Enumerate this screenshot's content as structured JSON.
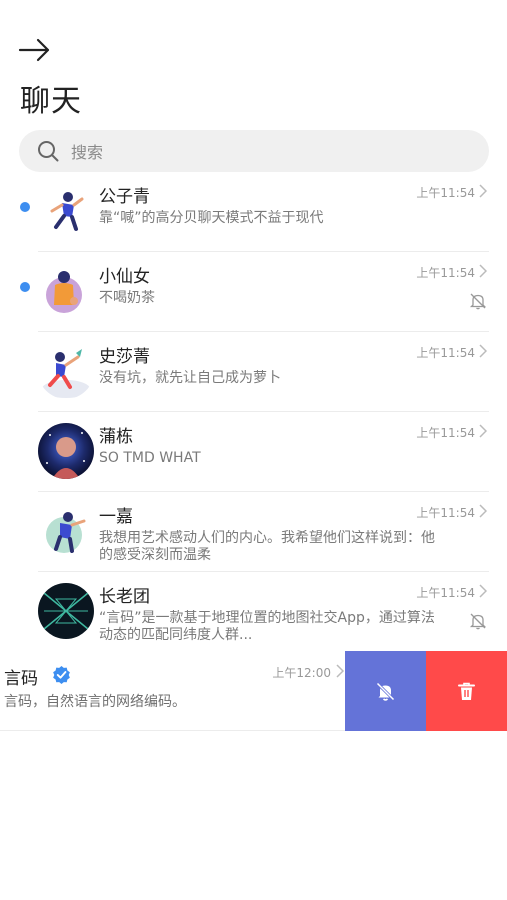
{
  "header": {
    "title": "聊天",
    "back_icon": "arrow-right-icon"
  },
  "search": {
    "placeholder": "搜索",
    "value": ""
  },
  "chats": [
    {
      "name": "公子青",
      "preview": "靠“喊”的高分贝聊天模式不益于现代",
      "time": "上午11:54",
      "unread": true,
      "muted": false
    },
    {
      "name": "小仙女",
      "preview": "不喝奶茶",
      "time": "上午11:54",
      "unread": true,
      "muted": true
    },
    {
      "name": "史莎菁",
      "preview": "没有坑，就先让自己成为萝卜",
      "time": "上午11:54",
      "unread": false,
      "muted": false
    },
    {
      "name": "蒲栋",
      "preview": "SO TMD WHAT",
      "time": "上午11:54",
      "unread": false,
      "muted": false
    },
    {
      "name": "一嘉",
      "preview": "我想用艺术感动人们的内心。我希望他们这样说到：他的感受深刻而温柔",
      "time": "上午11:54",
      "unread": false,
      "muted": false
    },
    {
      "name": "长老团",
      "preview": "“言码”是一款基于地理位置的地图社交App，通过算法动态的匹配同纬度人群...",
      "time": "上午11:54",
      "unread": false,
      "muted": true
    }
  ],
  "swiped_chat": {
    "name": "言码",
    "preview": "言码，自然语言的网络编码。",
    "time": "上午12:00",
    "verified": true,
    "actions": {
      "mute_icon": "bell-off-icon",
      "delete_icon": "trash-icon"
    }
  },
  "colors": {
    "unread_dot": "#3d8ef0",
    "mute_action": "#6473d8",
    "delete_action": "#ff4a4a",
    "verified": "#3d8ef0"
  }
}
